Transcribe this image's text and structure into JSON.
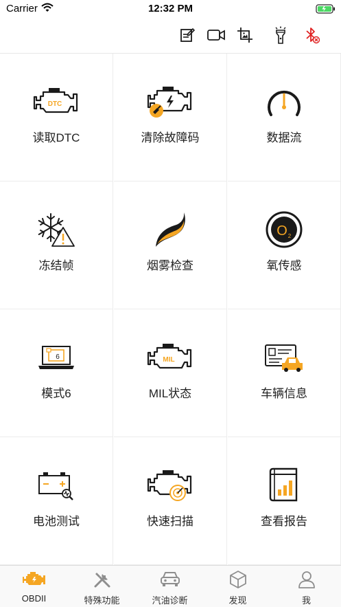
{
  "status_bar": {
    "carrier": "Carrier",
    "time": "12:32 PM"
  },
  "toolbar": {
    "items": [
      {
        "icon": "edit-note-icon"
      },
      {
        "icon": "video-camera-icon"
      },
      {
        "icon": "crop-image-icon"
      },
      {
        "icon": "flashlight-icon"
      },
      {
        "icon": "bluetooth-disconnected-icon"
      }
    ]
  },
  "colors": {
    "accent": "#f5a623",
    "icon": "#1a1a1a",
    "bluetooth_off": "#e02020",
    "inactive_tab": "#8e8e8e"
  },
  "menu": {
    "items": [
      {
        "label": "读取DTC",
        "icon": "engine-dtc-icon",
        "badge": "DTC"
      },
      {
        "label": "清除故障码",
        "icon": "engine-clear-icon"
      },
      {
        "label": "数据流",
        "icon": "gauge-icon"
      },
      {
        "label": "冻结帧",
        "icon": "snowflake-warning-icon"
      },
      {
        "label": "烟雾检查",
        "icon": "smoke-icon"
      },
      {
        "label": "氧传感",
        "icon": "o2-sensor-icon",
        "badge": "O"
      },
      {
        "label": "模式6",
        "icon": "laptop-mode6-icon",
        "badge": "6"
      },
      {
        "label": "MIL状态",
        "icon": "engine-mil-icon",
        "badge": "MIL"
      },
      {
        "label": "车辆信息",
        "icon": "vehicle-info-icon"
      },
      {
        "label": "电池测试",
        "icon": "battery-test-icon"
      },
      {
        "label": "快速扫描",
        "icon": "engine-quick-scan-icon"
      },
      {
        "label": "查看报告",
        "icon": "report-book-icon"
      }
    ]
  },
  "tabbar": {
    "tabs": [
      {
        "label": "OBDII",
        "icon": "engine-tab-icon",
        "active": true
      },
      {
        "label": "特殊功能",
        "icon": "tools-tab-icon",
        "active": false
      },
      {
        "label": "汽油诊断",
        "icon": "car-tab-icon",
        "active": false
      },
      {
        "label": "发现",
        "icon": "cube-tab-icon",
        "active": false
      },
      {
        "label": "我",
        "icon": "person-tab-icon",
        "active": false
      }
    ]
  }
}
